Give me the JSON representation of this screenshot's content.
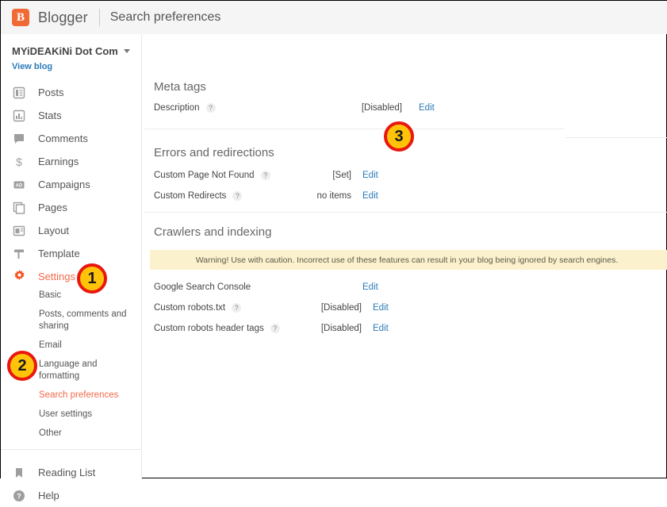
{
  "topbar": {
    "logo_icon": "blogger-logo-icon",
    "logo_glyph": "B",
    "brand": "Blogger",
    "section_title": "Search preferences"
  },
  "sidebar": {
    "blog_title": "MYiDEAKiNi Dot Com",
    "caret_icon": "chevron-down-icon",
    "view_blog": "View blog",
    "items": [
      {
        "label": "Posts",
        "icon": "posts-icon"
      },
      {
        "label": "Stats",
        "icon": "stats-bar-chart-icon"
      },
      {
        "label": "Comments",
        "icon": "comment-bubble-icon"
      },
      {
        "label": "Earnings",
        "icon": "dollar-sign-icon"
      },
      {
        "label": "Campaigns",
        "icon": "ad-campaign-icon"
      },
      {
        "label": "Pages",
        "icon": "pages-icon"
      },
      {
        "label": "Layout",
        "icon": "layout-icon"
      },
      {
        "label": "Template",
        "icon": "template-icon"
      },
      {
        "label": "Settings",
        "icon": "gear-icon"
      }
    ],
    "settings_sub_items": [
      {
        "label": "Basic"
      },
      {
        "label": "Posts, comments and sharing"
      },
      {
        "label": "Email"
      },
      {
        "label": "Language and formatting"
      },
      {
        "label": "Search preferences"
      },
      {
        "label": "User settings"
      },
      {
        "label": "Other"
      }
    ],
    "bottom_items": [
      {
        "label": "Reading List",
        "icon": "bookmark-icon"
      },
      {
        "label": "Help",
        "icon": "help-circle-icon"
      }
    ]
  },
  "main": {
    "meta_tags": {
      "heading": "Meta tags",
      "rows": [
        {
          "label": "Description",
          "help": "?",
          "value": "[Disabled]",
          "edit": "Edit"
        }
      ]
    },
    "errors": {
      "heading": "Errors and redirections",
      "rows": [
        {
          "label": "Custom Page Not Found",
          "help": "?",
          "value": "[Set]",
          "edit": "Edit"
        },
        {
          "label": "Custom Redirects",
          "help": "?",
          "value": "no items",
          "edit": "Edit"
        }
      ]
    },
    "crawlers": {
      "heading": "Crawlers and indexing",
      "warning": "Warning! Use with caution. Incorrect use of these features can result in your blog being ignored by search engines.",
      "rows": [
        {
          "label": "Google Search Console",
          "help": "",
          "value": "",
          "edit": "Edit"
        },
        {
          "label": "Custom robots.txt",
          "help": "?",
          "value": "[Disabled]",
          "edit": "Edit"
        },
        {
          "label": "Custom robots header tags",
          "help": "?",
          "value": "[Disabled]",
          "edit": "Edit"
        }
      ]
    }
  },
  "callouts": [
    {
      "number": "1"
    },
    {
      "number": "2"
    },
    {
      "number": "3"
    }
  ],
  "colors": {
    "accent_orange": "#f4694a",
    "logo_orange": "#f06a35",
    "link_blue": "#2b7bb9",
    "warning_bg": "#fcf1cd",
    "badge_fill": "#ffc40a",
    "badge_ring": "#e8170f"
  }
}
